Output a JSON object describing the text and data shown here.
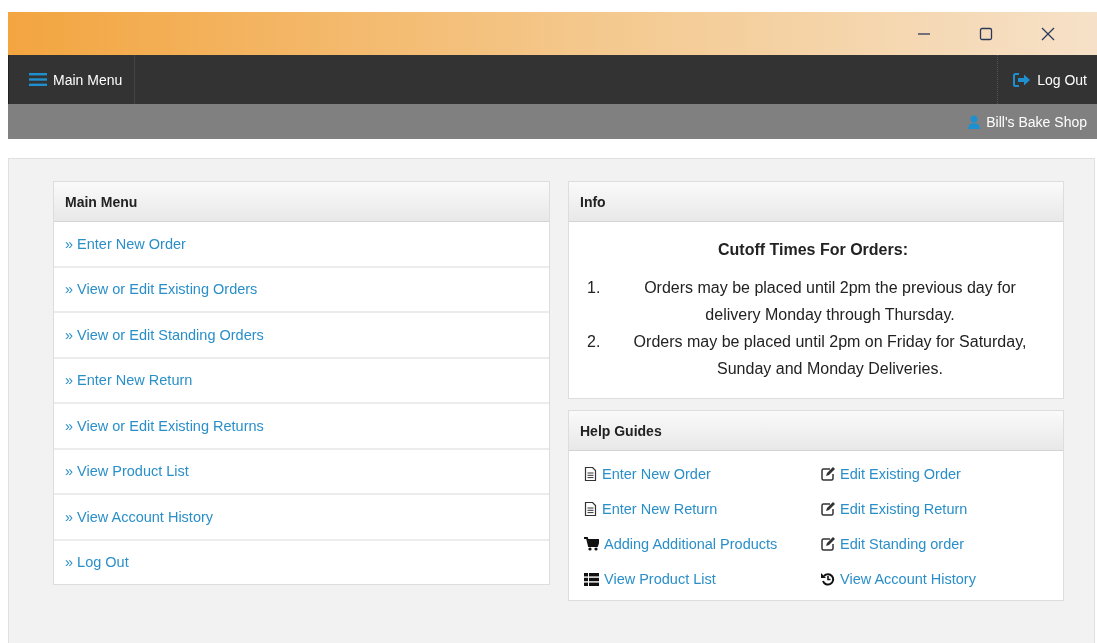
{
  "window": {
    "controls": [
      {
        "kind": "minimize"
      },
      {
        "kind": "maximize"
      },
      {
        "kind": "close"
      }
    ]
  },
  "navbar": {
    "menu_button": "Main Menu",
    "logout_button": "Log Out"
  },
  "user_bar": {
    "user": "Bill's Bake Shop"
  },
  "main_menu": {
    "title": "Main Menu",
    "items": [
      {
        "label": "» Enter New Order"
      },
      {
        "label": "» View or Edit Existing Orders"
      },
      {
        "label": "» View or Edit Standing Orders"
      },
      {
        "label": "» Enter New Return"
      },
      {
        "label": "» View or Edit Existing Returns"
      },
      {
        "label": "» View Product List"
      },
      {
        "label": "» View Account History"
      },
      {
        "label": "» Log Out"
      }
    ]
  },
  "info": {
    "title": "Info",
    "heading": "Cutoff Times For Orders:",
    "items": [
      {
        "number": "1.",
        "text": "Orders may be placed until 2pm the previous day for delivery Monday through Thursday."
      },
      {
        "number": "2.",
        "text": "Orders may be placed until 2pm on Friday for Saturday, Sunday and Monday Deliveries."
      }
    ]
  },
  "help_guides": {
    "title": "Help Guides",
    "items": [
      {
        "kind": "doc",
        "label": "Enter New Order"
      },
      {
        "kind": "edit",
        "label": "Edit Existing Order"
      },
      {
        "kind": "doc",
        "label": "Enter New Return"
      },
      {
        "kind": "edit",
        "label": "Edit Existing Return"
      },
      {
        "kind": "cart",
        "label": "Adding Additional Products"
      },
      {
        "kind": "edit",
        "label": "Edit Standing order"
      },
      {
        "kind": "list",
        "label": "View Product List"
      },
      {
        "kind": "history",
        "label": "View Account History"
      }
    ]
  }
}
